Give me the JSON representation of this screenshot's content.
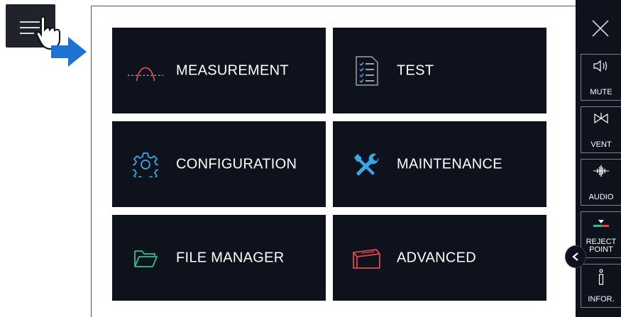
{
  "menu": {
    "tiles": [
      {
        "label": "MEASUREMENT",
        "icon": "measurement-curve-icon"
      },
      {
        "label": "TEST",
        "icon": "checklist-document-icon"
      },
      {
        "label": "CONFIGURATION",
        "icon": "gear-icon"
      },
      {
        "label": "MAINTENANCE",
        "icon": "wrench-screwdriver-icon"
      },
      {
        "label": "FILE MANAGER",
        "icon": "folder-icon"
      },
      {
        "label": "ADVANCED",
        "icon": "advanced-box-icon"
      }
    ]
  },
  "sidebar": {
    "close_icon": "close-icon",
    "buttons": [
      {
        "label": "MUTE",
        "icon": "speaker-icon"
      },
      {
        "label": "VENT",
        "icon": "valve-icon"
      },
      {
        "label": "AUDIO",
        "icon": "waveform-icon"
      },
      {
        "label": "REJECT POINT",
        "line1": "REJECT",
        "line2": "POINT",
        "icon": "reject-point-icon"
      },
      {
        "label": "INFOR.",
        "icon": "info-icon"
      }
    ]
  },
  "colors": {
    "tile_bg": "#0e121d",
    "accent_blue": "#1e73d2",
    "icon_cyan": "#3ba8e6",
    "icon_red": "#e04848",
    "icon_green": "#2fbf8f"
  }
}
